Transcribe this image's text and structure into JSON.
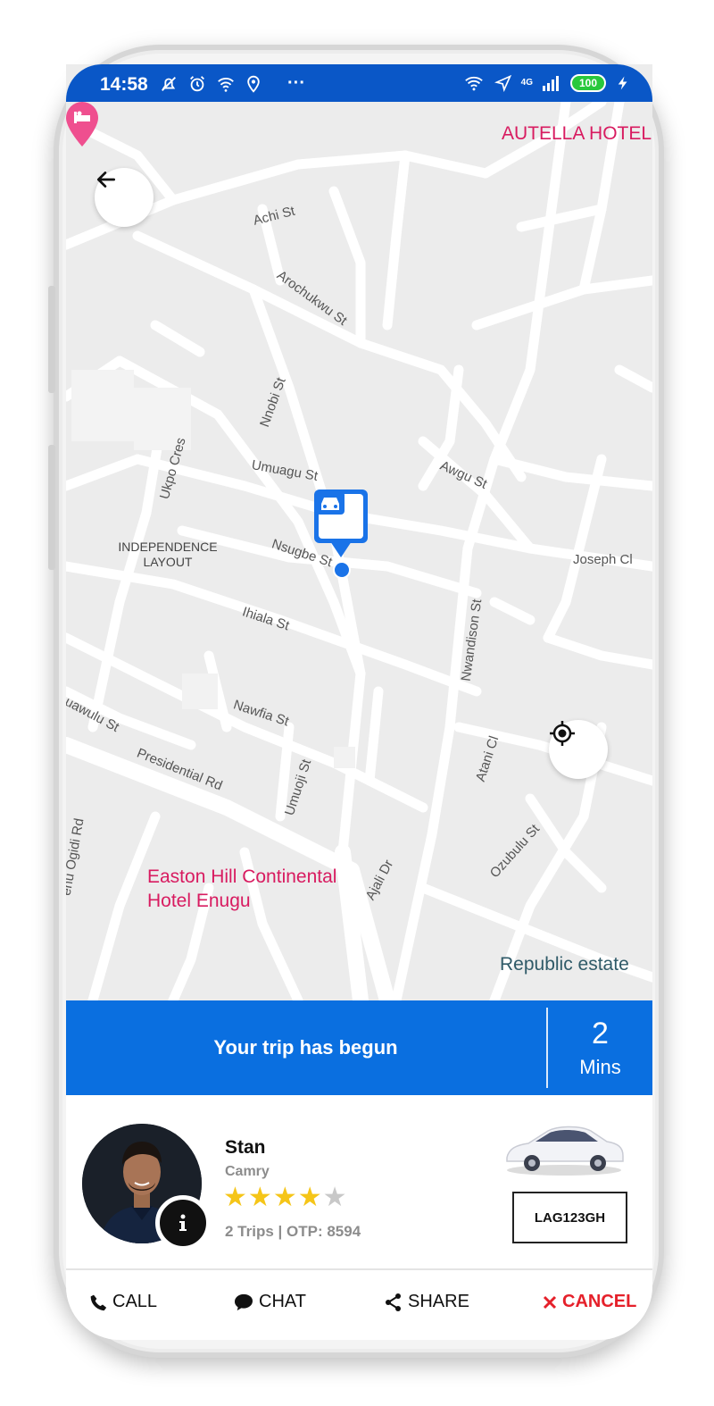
{
  "status_bar": {
    "time": "14:58",
    "more": "···",
    "network_type": "4G",
    "battery": "100"
  },
  "map": {
    "streets": [
      "Achi St",
      "Arochukwu St",
      "Nnobi St",
      "Ukpo Cres",
      "Umuagu St",
      "Awgu St",
      "Nsugbe St",
      "Nwandison St",
      "Joseph Cl",
      "Ihiala St",
      "Nawfia St",
      "uawulu St",
      "Presidential Rd",
      "Umuoji St",
      "Atani Cl",
      "Ozubulu St",
      "enu Ogidi Rd",
      "Ajali Dr"
    ],
    "area_label_line1": "INDEPENDENCE",
    "area_label_line2": "LAYOUT",
    "poi_top": "AUTELLA HOTEL",
    "poi_hotel_line1": "Easton Hill Continental",
    "poi_hotel_line2": "Hotel Enugu",
    "place": "Republic estate"
  },
  "trip": {
    "status": "Your trip has begun",
    "eta_value": "2",
    "eta_unit": "Mins"
  },
  "driver": {
    "name": "Stan",
    "car_model": "Camry",
    "rating": 4,
    "rating_max": 5,
    "trip_meta": "2 Trips | OTP: 8594",
    "plate": "LAG123GH"
  },
  "actions": {
    "call": "CALL",
    "chat": "CHAT",
    "share": "SHARE",
    "cancel": "CANCEL"
  },
  "colors": {
    "primary": "#0a6fe0",
    "status_bar": "#0a57c7",
    "cancel": "#e5202a",
    "star_on": "#f5c518",
    "star_off": "#c8c8c8",
    "poi": "#d81b60"
  }
}
